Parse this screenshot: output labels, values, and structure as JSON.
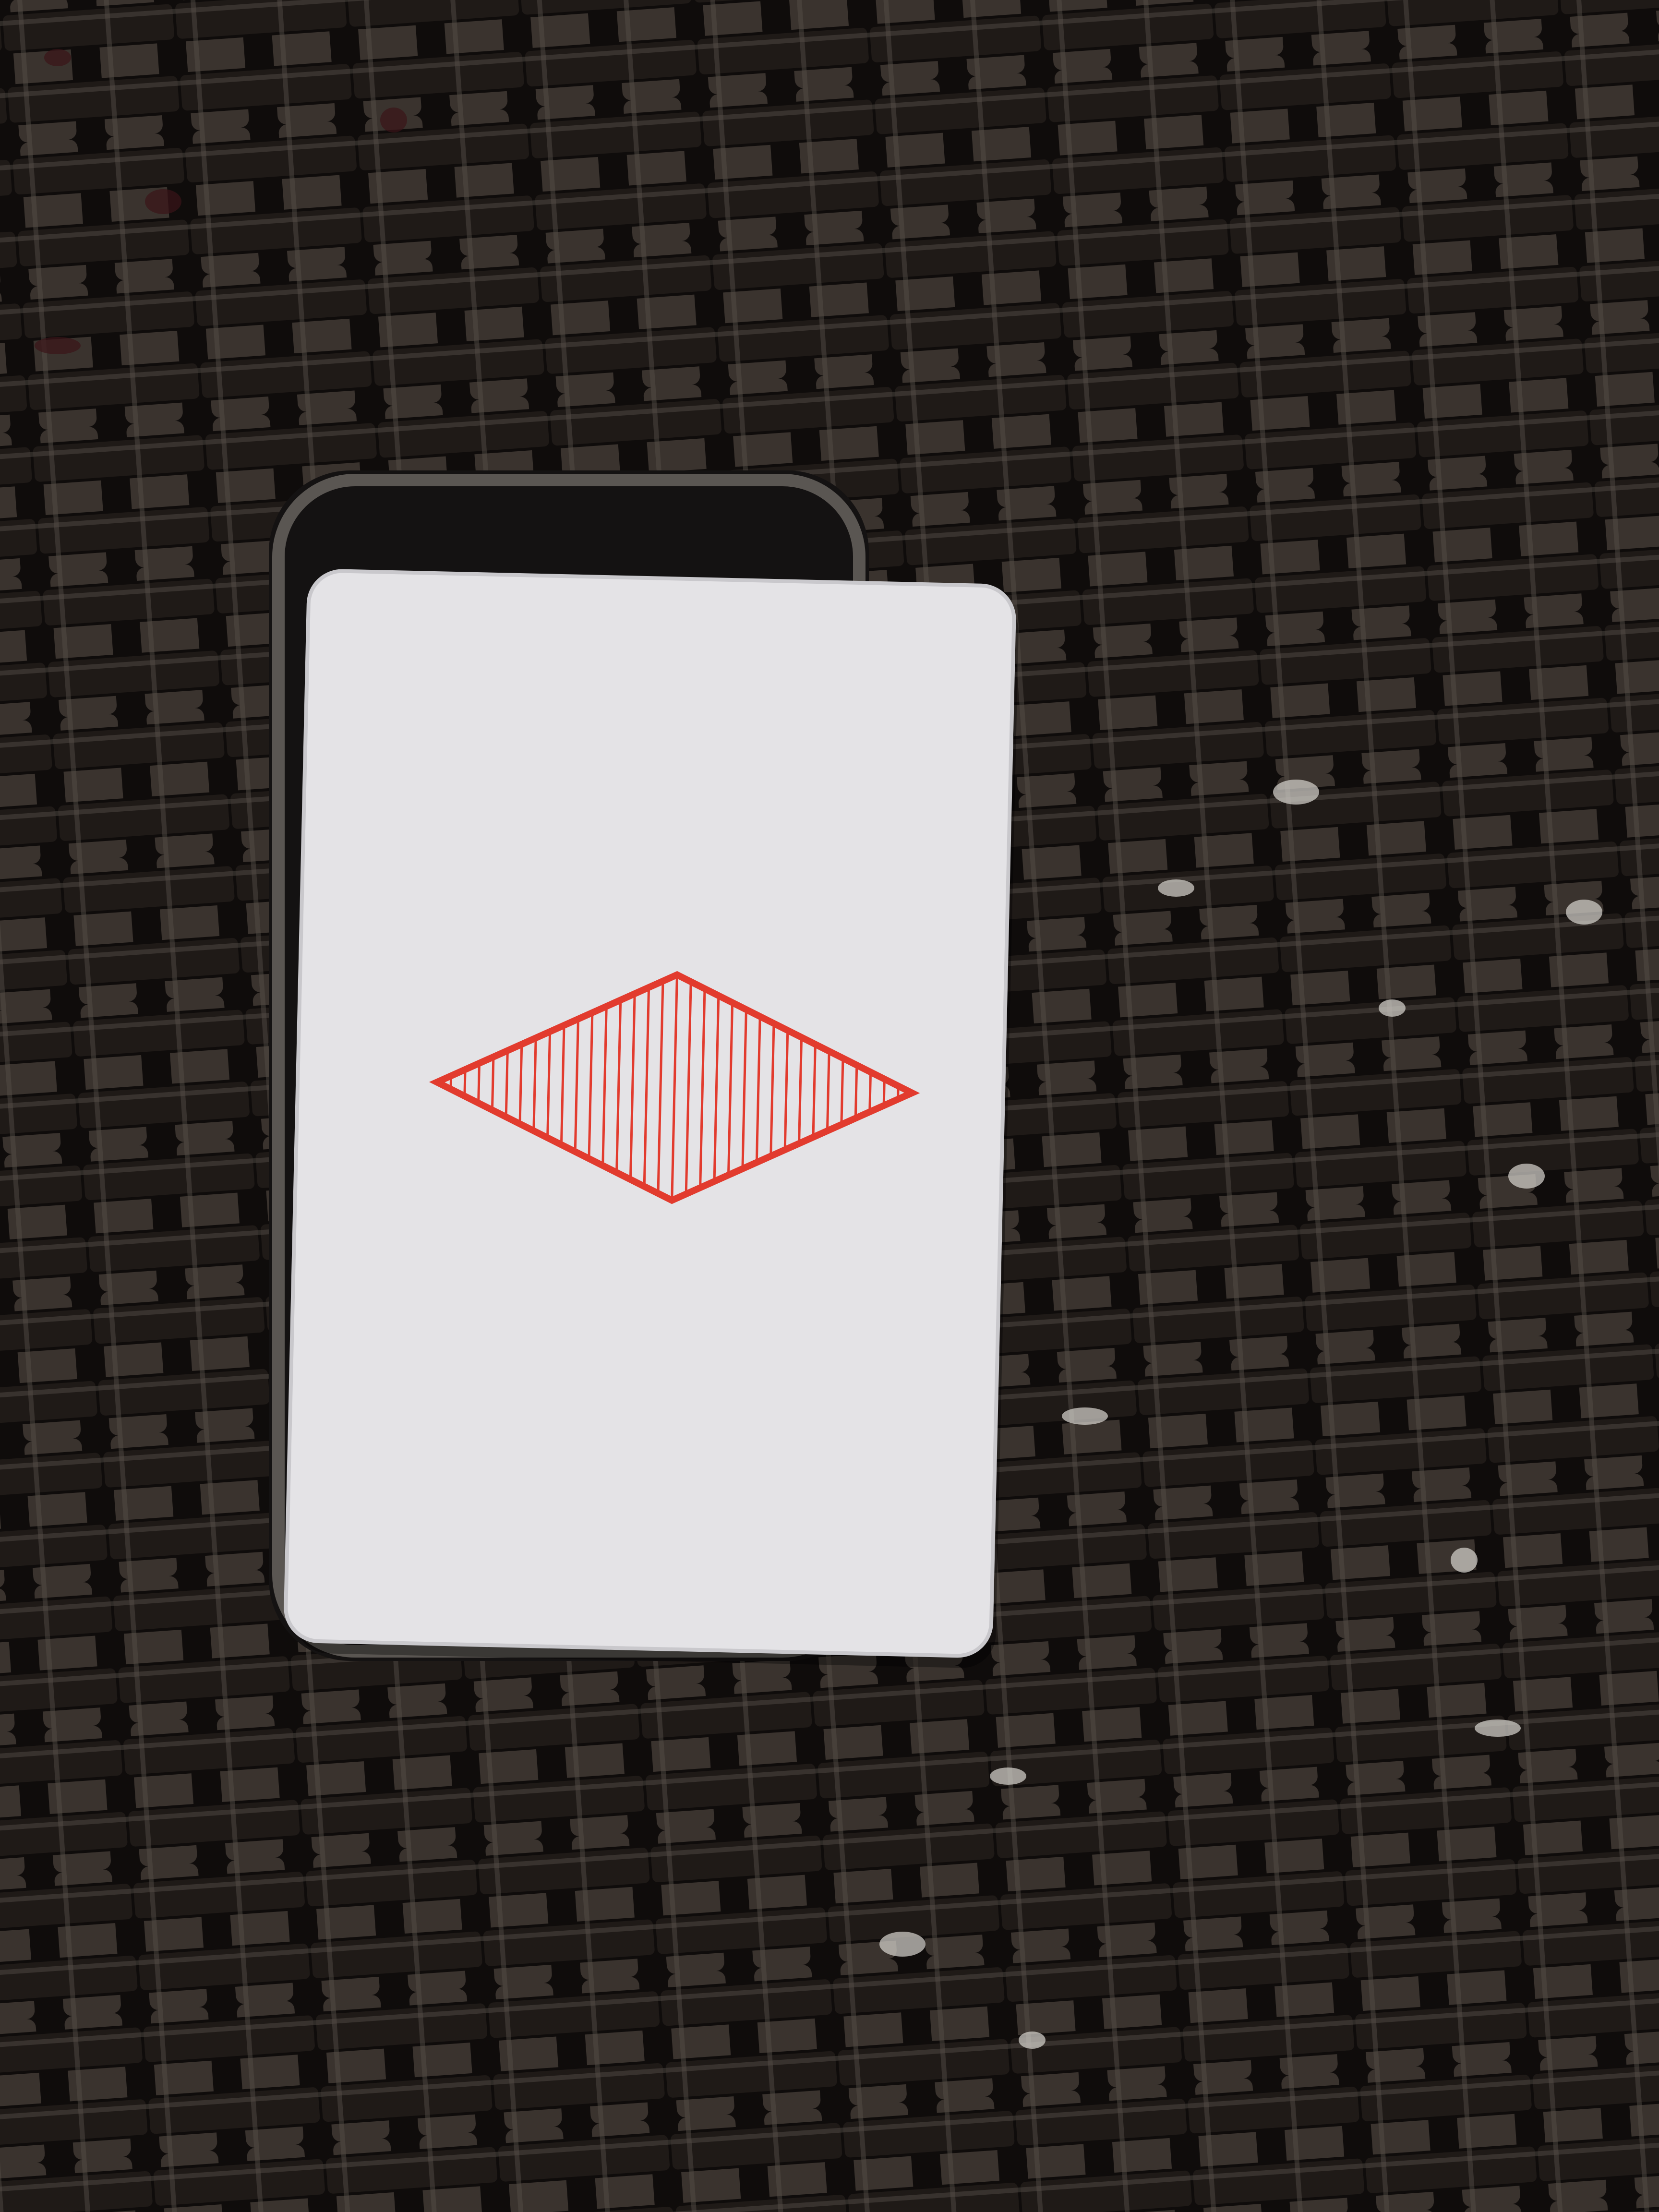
{
  "scene": {
    "subjects": [
      "wicker-surface",
      "tin-case",
      "playing-card",
      "hatched-diamond"
    ]
  },
  "colors": {
    "weave_dark": "#1f1a17",
    "weave_mid": "#3a332e",
    "weave_highlight": "#57504a",
    "gap_dark": "#0f0c0b",
    "gap_accent_red": "#3a1418",
    "gap_accent_white": "#d9d5d0",
    "tin_rim": "#5a5652",
    "tin_body": "#141212",
    "card_face": "#e4e3e6",
    "card_edge": "#c9c8cc",
    "diamond_red": "#e23b2e"
  },
  "card": {
    "symbol": "diamond",
    "pattern": "vertical-hatching",
    "hatch_line_count": 34
  }
}
